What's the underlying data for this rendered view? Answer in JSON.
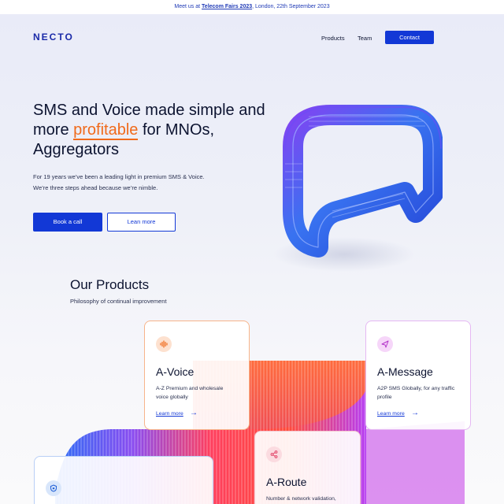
{
  "announcement": {
    "prefix": "Meet us at ",
    "event": "Telecom Fairs 2023",
    "suffix": ", London,  22th September 2023"
  },
  "header": {
    "logo": "NECTO",
    "nav": [
      "Products",
      "Team"
    ],
    "contact_label": "Contact"
  },
  "hero": {
    "headline_part1": "SMS and Voice made simple and more ",
    "headline_accent": "profitable",
    "headline_part2": " for MNOs, Aggregators",
    "subtext_line1": "For 19 years we’ve been a leading light in premium SMS & Voice.",
    "subtext_line2": "We’re three steps ahead because we’re nimble.",
    "book_label": "Book a call",
    "learn_label": "Lean more"
  },
  "products": {
    "title": "Our Products",
    "subtitle": "Philosophy of continual improvement",
    "cards": [
      {
        "title": "A-Voice",
        "desc": "A-Z Premium and wholesale voice globally",
        "link": "Learn more",
        "icon": "sound-wave-icon"
      },
      {
        "title": "A-Message",
        "desc": "A2P SMS Globally, for any traffic profile",
        "link": "Learn more",
        "icon": "paper-plane-icon"
      },
      {
        "title": "A-Route",
        "desc": "Number & network validation,",
        "icon": "share-nodes-icon"
      },
      {
        "title": "",
        "desc": "",
        "icon": "shield-icon"
      }
    ]
  },
  "colors": {
    "brand": "#1238d6",
    "accent": "#f06a1b"
  }
}
